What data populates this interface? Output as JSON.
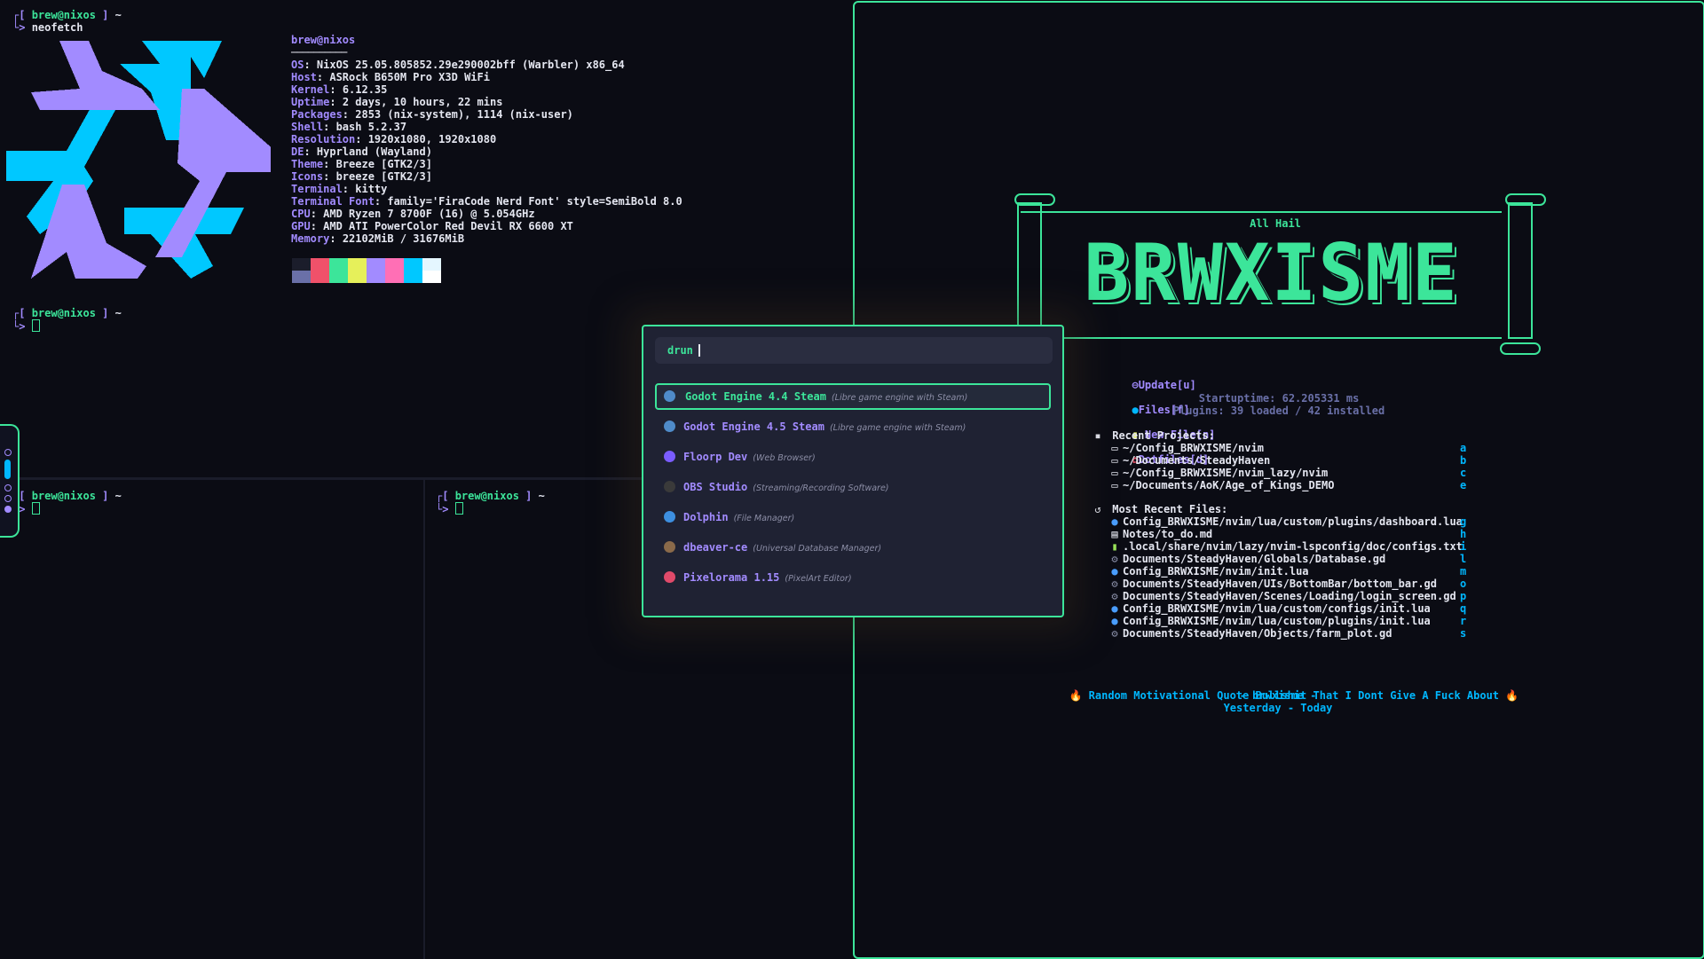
{
  "colors": {
    "accent": "#3ce59a",
    "purple": "#a28bff",
    "cyan": "#00b7ff",
    "bg": "#0b0c14"
  },
  "terminal_main": {
    "prompt_user": "brew@nixos",
    "prompt_tilde": "~",
    "command": "neofetch",
    "info_title": "brew@nixos",
    "info_rule": "──────────",
    "info": [
      {
        "k": "OS",
        "v": "NixOS 25.05.805852.29e290002bff (Warbler) x86_64"
      },
      {
        "k": "Host",
        "v": "ASRock B650M Pro X3D WiFi"
      },
      {
        "k": "Kernel",
        "v": "6.12.35"
      },
      {
        "k": "Uptime",
        "v": "2 days, 10 hours, 22 mins"
      },
      {
        "k": "Packages",
        "v": "2853 (nix-system), 1114 (nix-user)"
      },
      {
        "k": "Shell",
        "v": "bash 5.2.37"
      },
      {
        "k": "Resolution",
        "v": "1920x1080, 1920x1080"
      },
      {
        "k": "DE",
        "v": "Hyprland (Wayland)"
      },
      {
        "k": "Theme",
        "v": "Breeze [GTK2/3]"
      },
      {
        "k": "Icons",
        "v": "breeze [GTK2/3]"
      },
      {
        "k": "Terminal",
        "v": "kitty"
      },
      {
        "k": "Terminal Font",
        "v": "family='FiraCode Nerd Font' style=SemiBold 8.0"
      },
      {
        "k": "CPU",
        "v": "AMD Ryzen 7 8700F (16) @ 5.054GHz"
      },
      {
        "k": "GPU",
        "v": "AMD ATI PowerColor Red Devil RX 6600 XT"
      },
      {
        "k": "Memory",
        "v": "22102MiB / 31676MiB"
      }
    ],
    "swatch_row1": [
      "#1b1d2b",
      "#f0516a",
      "#3ce59a",
      "#e6f05a",
      "#a28bff",
      "#ff6fb5",
      "#00c8ff",
      "#e4f6ff"
    ],
    "swatch_row2": [
      "#6a70a8",
      "#f0516a",
      "#3ce59a",
      "#e6f05a",
      "#a28bff",
      "#ff6fb5",
      "#00c8ff",
      "#ffffff"
    ]
  },
  "launcher": {
    "mode": "drun",
    "items": [
      {
        "name": "Godot Engine 4.4 Steam",
        "desc": "(Libre game engine with Steam)",
        "icon": "godot-icon",
        "color": "#4f8bc9"
      },
      {
        "name": "Godot Engine 4.5 Steam",
        "desc": "(Libre game engine with Steam)",
        "icon": "godot-icon",
        "color": "#4f8bc9"
      },
      {
        "name": "Floorp Dev",
        "desc": "(Web Browser)",
        "icon": "floorp-icon",
        "color": "#7a5cff"
      },
      {
        "name": "OBS Studio",
        "desc": "(Streaming/Recording Software)",
        "icon": "obs-icon",
        "color": "#3a3a3a"
      },
      {
        "name": "Dolphin",
        "desc": "(File Manager)",
        "icon": "dolphin-icon",
        "color": "#3d8fe0"
      },
      {
        "name": "dbeaver-ce",
        "desc": "(Universal Database Manager)",
        "icon": "dbeaver-icon",
        "color": "#8a6a4a"
      },
      {
        "name": "Pixelorama 1.15",
        "desc": "(PixelArt Editor)",
        "icon": "pixelorama-icon",
        "color": "#e04a6a"
      }
    ]
  },
  "dashboard": {
    "subtitle": "All Hail",
    "title": "BRWXISME",
    "buttons": [
      {
        "icon": "update-icon",
        "label": "Update[u]"
      },
      {
        "icon": "files-icon",
        "label": "Files[f]"
      },
      {
        "icon": "new-file-icon",
        "label": "New File[n]"
      },
      {
        "icon": "gear-icon",
        "label": "Dotfiles[d]"
      }
    ],
    "startup": "Startuptime: 62.205331 ms",
    "plugins": "Plugins: 39 loaded / 42 installed",
    "recent_projects_label": "Recent Projects:",
    "projects": [
      {
        "path": "~/Config_BRWXISME/nvim",
        "key": "a"
      },
      {
        "path": "~/Documents/SteadyHaven",
        "key": "b"
      },
      {
        "path": "~/Config_BRWXISME/nvim_lazy/nvim",
        "key": "c"
      },
      {
        "path": "~/Documents/AoK/Age_of_Kings_DEMO",
        "key": "e"
      }
    ],
    "recent_files_label": "Most Recent Files:",
    "files": [
      {
        "path": "Config_BRWXISME/nvim/lua/custom/plugins/dashboard.lua",
        "key": "g",
        "type": "lua"
      },
      {
        "path": "Notes/to_do.md",
        "key": "h",
        "type": "md"
      },
      {
        "path": ".local/share/nvim/lazy/nvim-lspconfig/doc/configs.txt",
        "key": "i",
        "type": "txt"
      },
      {
        "path": "Documents/SteadyHaven/Globals/Database.gd",
        "key": "l",
        "type": "gd"
      },
      {
        "path": "Config_BRWXISME/nvim/init.lua",
        "key": "m",
        "type": "lua"
      },
      {
        "path": "Documents/SteadyHaven/UIs/BottomBar/bottom_bar.gd",
        "key": "o",
        "type": "gd"
      },
      {
        "path": "Documents/SteadyHaven/Scenes/Loading/login_screen.gd",
        "key": "p",
        "type": "gd"
      },
      {
        "path": "Config_BRWXISME/nvim/lua/custom/configs/init.lua",
        "key": "q",
        "type": "lua"
      },
      {
        "path": "Config_BRWXISME/nvim/lua/custom/plugins/init.lua",
        "key": "r",
        "type": "lua"
      },
      {
        "path": "Documents/SteadyHaven/Objects/farm_plot.gd",
        "key": "s",
        "type": "gd"
      }
    ],
    "quote": "Random Motivational Quote Bullshit That I Dont Give A Fuck About",
    "quote_author": "- brwxisme -",
    "quote_time": "Yesterday - Today"
  }
}
